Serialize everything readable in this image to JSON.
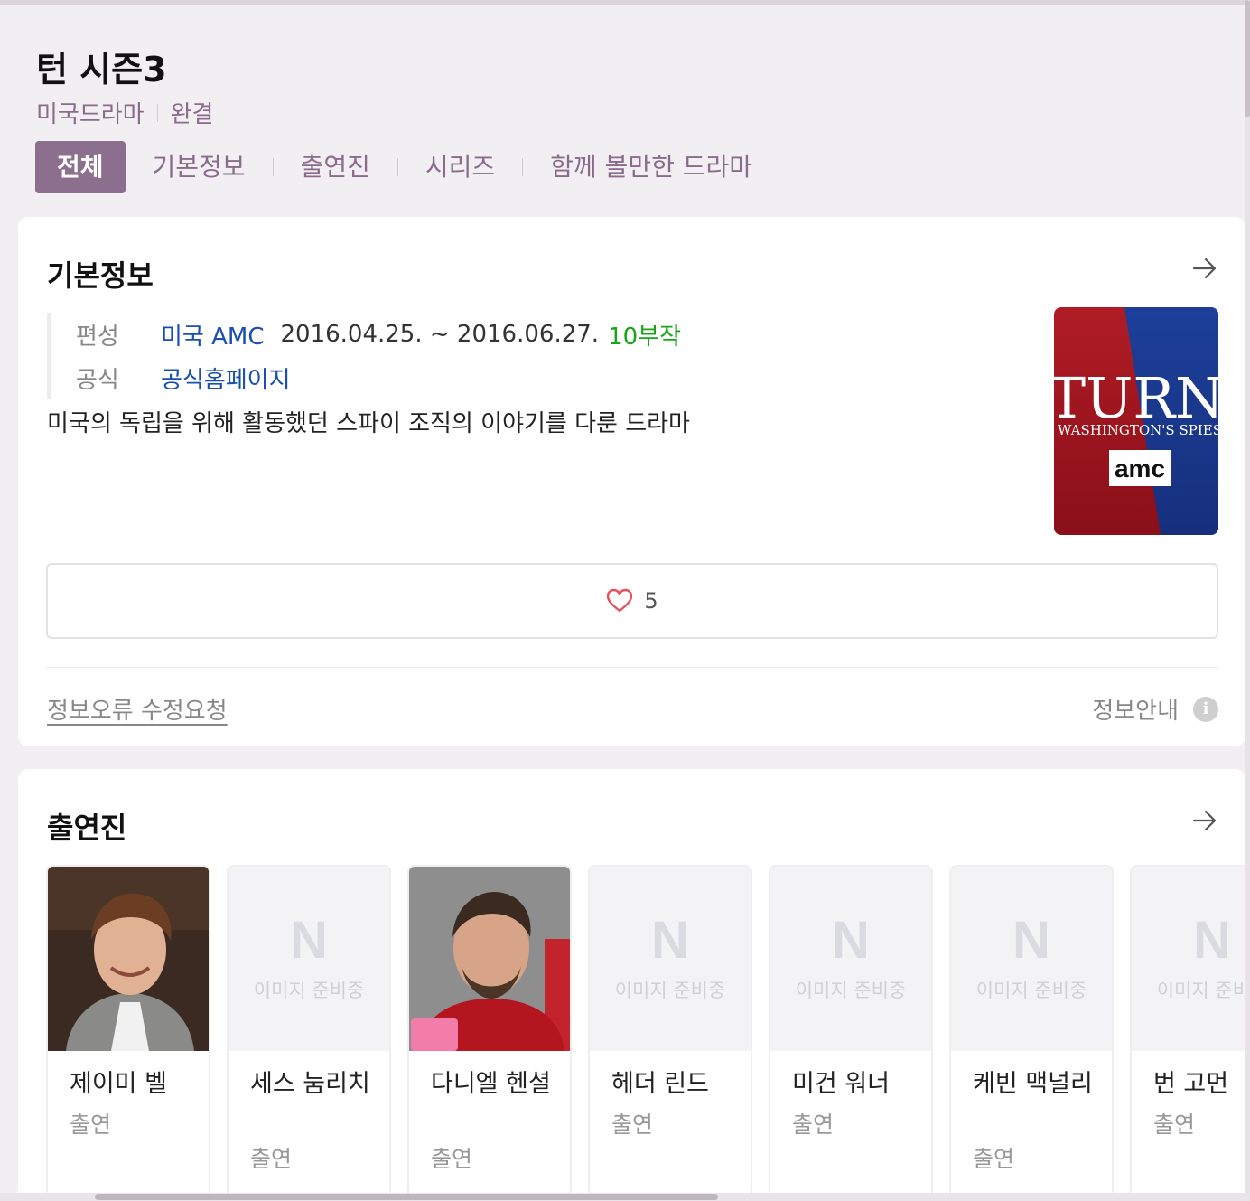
{
  "header": {
    "title": "턴 시즌3",
    "meta": [
      "미국드라마",
      "완결"
    ]
  },
  "tabs": [
    {
      "label": "전체",
      "active": true
    },
    {
      "label": "기본정보",
      "active": false
    },
    {
      "label": "출연진",
      "active": false
    },
    {
      "label": "시리즈",
      "active": false
    },
    {
      "label": "함께 볼만한 드라마",
      "active": false
    }
  ],
  "basic_info": {
    "title": "기본정보",
    "broadcast_label": "편성",
    "broadcast_network": "미국 AMC",
    "period": "2016.04.25. ~ 2016.06.27.",
    "episodes": "10부작",
    "official_label": "공식",
    "official_link": "공식홈페이지",
    "description": "미국의 독립을 위해 활동했던 스파이 조직의 이야기를 다룬 드라마",
    "poster": {
      "title_text": "TURN",
      "tagline": "WASHINGTON'S SPIES",
      "logo": "amc"
    },
    "like_count": "5",
    "report_link": "정보오류 수정요청",
    "guide_label": "정보안내",
    "info_icon": "i"
  },
  "cast": {
    "title": "출연진",
    "no_image_label": "이미지 준비중",
    "no_image_letter": "N",
    "members": [
      {
        "name": "제이미 벨",
        "role": "출연",
        "has_photo": true
      },
      {
        "name": "세스 눔리치",
        "role": "출연",
        "has_photo": false
      },
      {
        "name": "다니엘 헨셜",
        "role": "출연",
        "has_photo": true
      },
      {
        "name": "헤더 린드",
        "role": "출연",
        "has_photo": false
      },
      {
        "name": "미건 워너",
        "role": "출연",
        "has_photo": false
      },
      {
        "name": "케빈 맥널리",
        "role": "출연",
        "has_photo": false
      },
      {
        "name": "번 고먼",
        "role": "출연",
        "has_photo": false
      }
    ]
  },
  "colors": {
    "accent": "#8c6f8e",
    "link": "#1a4fb0",
    "green": "#18a418",
    "heart": "#e8515c"
  }
}
